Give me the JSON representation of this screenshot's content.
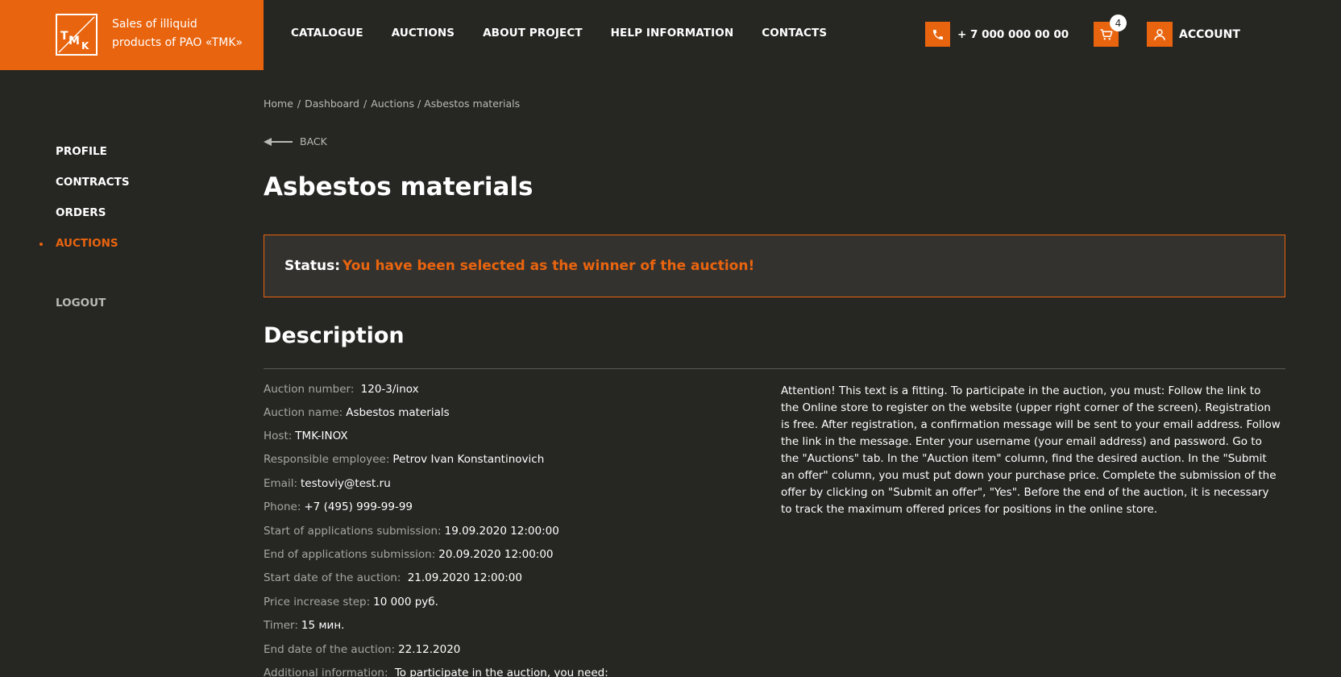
{
  "brand": {
    "logo_letters": "TMK",
    "tagline": "Sales of illiquid products of PAO «TMK»"
  },
  "nav": {
    "items": [
      "CATALOGUE",
      "AUCTIONS",
      "ABOUT PROJECT",
      "HELP INFORMATION",
      "CONTACTS"
    ]
  },
  "header": {
    "phone": "+ 7 000 000 00 00",
    "cart_count": "4",
    "account_label": "ACCOUNT",
    "icons": [
      "phone-icon",
      "cart-icon",
      "user-icon"
    ]
  },
  "sidebar": {
    "items": [
      "PROFILE",
      "CONTRACTS",
      "ORDERS",
      "AUCTIONS"
    ],
    "active": "AUCTIONS",
    "logout": "LOGOUT"
  },
  "breadcrumb": {
    "items": [
      "Home",
      "Dashboard",
      "Auctions",
      "Asbestos materials"
    ]
  },
  "back_label": "BACK",
  "page_title": "Asbestos materials",
  "status": {
    "label": "Status:",
    "value": "You have been selected as the winner of the auction!"
  },
  "description": {
    "title": "Description",
    "fields": [
      {
        "key": "Auction number:",
        "value": " 120-3/inox"
      },
      {
        "key": "Auction name:",
        "value": "Asbestos materials"
      },
      {
        "key": "Host:",
        "value": "TMK-INOX"
      },
      {
        "key": "Responsible employee:",
        "value": "Petrov Ivan Konstantinovich"
      },
      {
        "key": "Email:",
        "value": "testoviy@test.ru"
      },
      {
        "key": "Phone:",
        "value": "+7 (495) 999-99-99"
      },
      {
        "key": "Start of applications submission:",
        "value": "19.09.2020 12:00:00"
      },
      {
        "key": "End of applications submission:",
        "value": "20.09.2020 12:00:00"
      },
      {
        "key": "Start date of the auction:",
        "value": " 21.09.2020 12:00:00"
      },
      {
        "key": "Price increase step:",
        "value": "10 000 руб."
      },
      {
        "key": "Timer:",
        "value": "15 мин."
      },
      {
        "key": "End date of the auction:",
        "value": "22.12.2020"
      },
      {
        "key": "Additional information:",
        "value": " To participate in the auction, you need:"
      }
    ],
    "notice": "Attention! This text is a fitting. To participate in the auction, you must: Follow the link to the Online store to register on the website (upper right corner of the screen). Registration is free. After registration, a confirmation message will be sent to your email address. Follow the link in the message. Enter your username (your email address) and password. Go to the \"Auctions\" tab. In the \"Auction item\" column, find the desired auction. In the \"Submit an offer\" column, you must put down your purchase price. Complete the submission of the offer by clicking on \"Submit an offer\", \"Yes\". Before the end of the auction, it is necessary to track the maximum offered prices for positions in the online store."
  },
  "colors": {
    "accent": "#e9640e",
    "background": "#262623",
    "muted_text": "#a6a6a2"
  }
}
